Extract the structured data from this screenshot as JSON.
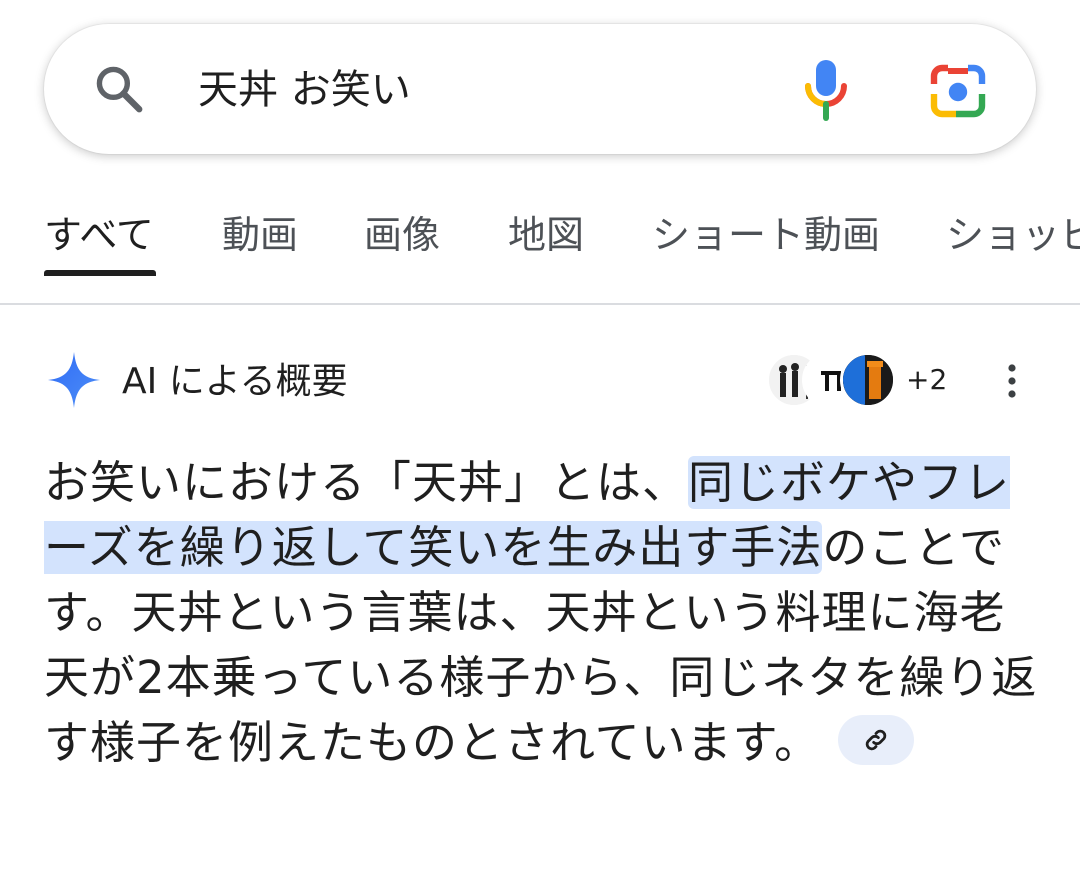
{
  "search": {
    "query": "天丼 お笑い"
  },
  "tabs": [
    {
      "label": "すべて",
      "active": true
    },
    {
      "label": "動画",
      "active": false
    },
    {
      "label": "画像",
      "active": false
    },
    {
      "label": "地図",
      "active": false
    },
    {
      "label": "ショート動画",
      "active": false
    },
    {
      "label": "ショッピ",
      "active": false
    }
  ],
  "ai_overview": {
    "title": "AI による概要",
    "sources_more": "+2",
    "text_before": "お笑いにおける「天丼」とは、",
    "text_highlight": "同じボケやフレーズを繰り返して笑いを生み出す手法",
    "text_after": "のことです。天丼という言葉は、天丼という料理に海老天が2本乗っている様子から、同じネタを繰り返す様子を例えたものとされています。"
  },
  "icons": {
    "search": "search-icon",
    "mic": "mic-icon",
    "lens": "lens-icon",
    "sparkle": "sparkle-icon",
    "more": "more-vert-icon",
    "link": "link-icon"
  },
  "colors": {
    "highlight": "#d3e3fd",
    "sparkle": "#3a6cf4",
    "link_chip": "#e8eefa"
  }
}
